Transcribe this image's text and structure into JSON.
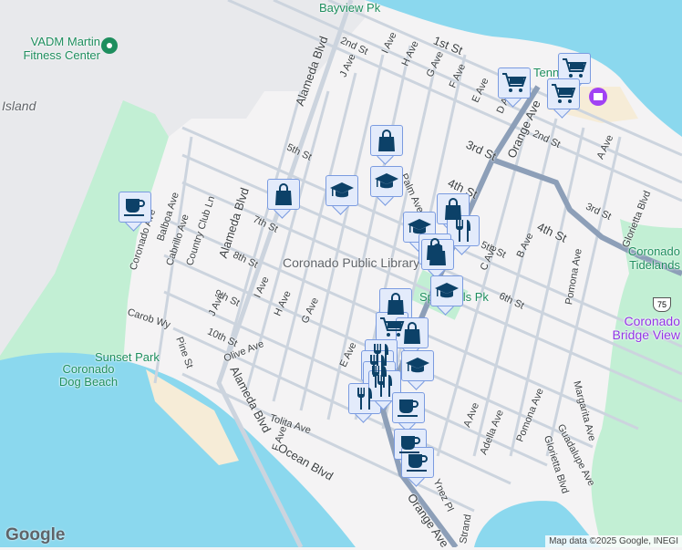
{
  "colors": {
    "water": "#8bd8ee",
    "land": "#f4f3f4",
    "base": "#e8e9ec",
    "park": "#c2efd4",
    "beach": "#f6ecd7",
    "road": "#ccd4de",
    "highway": "#8d9fb8",
    "marker_bg": "#e3ebfb",
    "marker_icon": "#0c4168"
  },
  "places": {
    "fitness": "VADM Martin Fitness Center",
    "library": "Coronado Public Library",
    "spreckels": "Spreckels Pk",
    "bayview": "Bayview Pk",
    "sunset": "Sunset Park",
    "dogbeach": "Coronado Dog Beach",
    "tidelands": "Coronado Tidelands",
    "bridge_view": "Coronado Bridge View",
    "tennis": "Tennis",
    "island": "Island"
  },
  "streets": {
    "alameda1": "Alameda Blvd",
    "alameda2": "Alameda Blvd",
    "alameda3": "Alameda Blvd",
    "st1": "1st St",
    "st2a": "2nd St",
    "st2b": "2nd St",
    "st3a": "3rd St",
    "st3b": "3rd St",
    "st4a": "4th St",
    "st4b": "4th St",
    "st5a": "5th St",
    "st5b": "5th St",
    "st6": "6th St",
    "st7": "7th St",
    "st8": "8th St",
    "st9": "9th St",
    "st10": "10th St",
    "iave": "I Ave",
    "jave": "J Ave",
    "have": "H Ave",
    "gave": "G Ave",
    "fave": "F Ave",
    "eave": "E Ave",
    "dave": "D Ave",
    "orange1": "Orange Ave",
    "orange2": "Orange Ave",
    "aave": "A Ave",
    "bave": "B Ave",
    "cave": "C Ave",
    "palm": "Palm Ave",
    "glorietta1": "Glorietta Blvd",
    "glorietta2": "Glorietta Blvd",
    "pomona1": "Pomona Ave",
    "pomona2": "Pomona Ave",
    "margarita": "Margarita Ave",
    "guadalupe": "Guadalupe Ave",
    "adella": "Adella Ave",
    "aave2": "A Ave",
    "coronado": "Coronado Ave",
    "balboa": "Balboa Ave",
    "cabrillo": "Cabrillo Ave",
    "country": "Country Club Ln",
    "carob": "Carob Wy",
    "pine": "Pine St",
    "olive": "Olive Ave",
    "tolita": "Tolita Ave",
    "ocean": "Ocean Blvd",
    "iave2": "I Ave",
    "have2": "H Ave",
    "gave2": "G Ave",
    "fave2": "F Ave",
    "eave2": "E Ave",
    "jave2": "J Ave",
    "inez": "Ynez Pl",
    "strand": "Strand"
  },
  "route_shield": "75",
  "markers": [
    {
      "category": "coffee"
    },
    {
      "category": "shopping"
    },
    {
      "category": "education"
    },
    {
      "category": "shopping"
    },
    {
      "category": "education"
    },
    {
      "category": "education"
    },
    {
      "category": "shopping"
    },
    {
      "category": "restaurant"
    },
    {
      "category": "shopping"
    },
    {
      "category": "shopping"
    },
    {
      "category": "education"
    },
    {
      "category": "shopping"
    },
    {
      "category": "grocery"
    },
    {
      "category": "shopping"
    },
    {
      "category": "restaurant"
    },
    {
      "category": "restaurant"
    },
    {
      "category": "restaurant"
    },
    {
      "category": "education"
    },
    {
      "category": "restaurant"
    },
    {
      "category": "restaurant"
    },
    {
      "category": "coffee"
    },
    {
      "category": "coffee"
    },
    {
      "category": "coffee"
    },
    {
      "category": "grocery"
    },
    {
      "category": "grocery"
    },
    {
      "category": "grocery"
    }
  ],
  "attribution": "Map data ©2025 Google, INEGI",
  "logo": "Google"
}
